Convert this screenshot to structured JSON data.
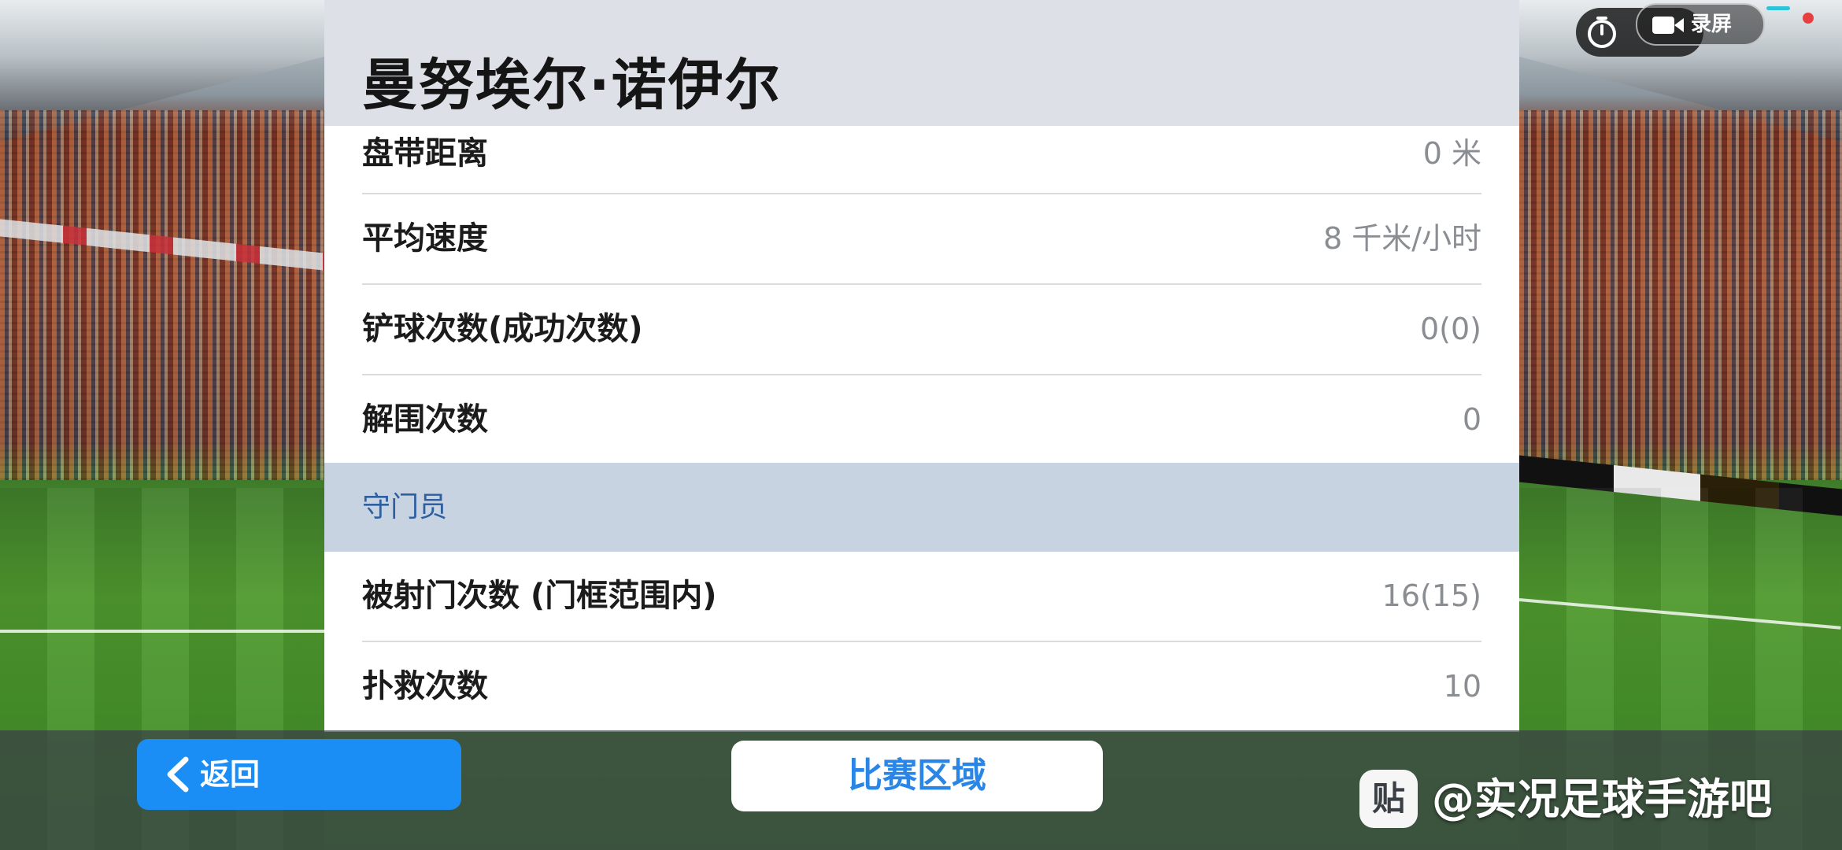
{
  "player": {
    "name": "曼努埃尔·诺伊尔"
  },
  "stats_top": [
    {
      "label": "盘带距离",
      "value": "0 米"
    },
    {
      "label": "平均速度",
      "value": "8 千米/小时"
    },
    {
      "label": "铲球次数(成功次数)",
      "value": "0(0)"
    },
    {
      "label": "解围次数",
      "value": "0"
    }
  ],
  "section_goalkeeper": {
    "title": "守门员"
  },
  "stats_goalkeeper": [
    {
      "label": "被射门次数 (门框范围内)",
      "value": "16(15)"
    },
    {
      "label": "扑救次数",
      "value": "10"
    }
  ],
  "footer": {
    "back_label": "返回",
    "match_area_label": "比赛区域"
  },
  "recorder": {
    "label": "录屏"
  },
  "watermark": {
    "logo": "贴",
    "text": "@实况足球手游吧"
  },
  "colors": {
    "accent_blue": "#1a8ef4",
    "section_bg": "#c8d3e2",
    "section_text": "#2f5f9e"
  },
  "icons": [
    "chevron-left-icon",
    "timer-icon",
    "video-camera-icon",
    "tieba-logo-icon"
  ]
}
